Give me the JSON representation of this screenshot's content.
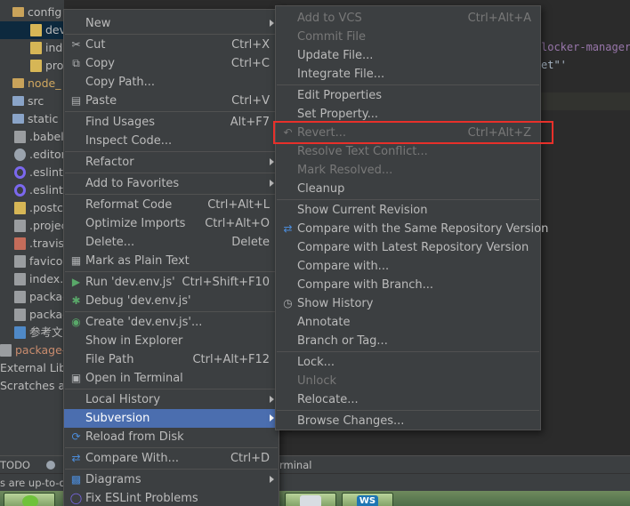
{
  "project_tree": {
    "rows": [
      {
        "label": "config",
        "icon": "folder-icon",
        "kind": "folder-o"
      },
      {
        "label": "dev",
        "icon": "js-file-icon",
        "kind": "js",
        "selected": true
      },
      {
        "label": "ind",
        "icon": "js-file-icon",
        "kind": "js"
      },
      {
        "label": "pro",
        "icon": "js-file-icon",
        "kind": "js"
      },
      {
        "label": "node_",
        "icon": "folder-icon",
        "kind": "folder-o",
        "orange": true
      },
      {
        "label": "src",
        "icon": "folder-icon",
        "kind": "folder"
      },
      {
        "label": "static",
        "icon": "folder-icon",
        "kind": "folder"
      },
      {
        "label": ".babel",
        "icon": "file-icon",
        "kind": "file"
      },
      {
        "label": ".editor",
        "icon": "gear-icon",
        "kind": "gear"
      },
      {
        "label": ".eslinti",
        "icon": "eslint-icon",
        "kind": "eslint"
      },
      {
        "label": ".eslintr",
        "icon": "eslint-icon",
        "kind": "eslint"
      },
      {
        "label": ".postc",
        "icon": "js-file-icon",
        "kind": "js"
      },
      {
        "label": ".projec",
        "icon": "file-icon",
        "kind": "file"
      },
      {
        "label": ".travis.",
        "icon": "yml-file-icon",
        "kind": "yml"
      },
      {
        "label": "favicor",
        "icon": "file-icon",
        "kind": "file"
      },
      {
        "label": "index.h",
        "icon": "html-file-icon",
        "kind": "file"
      },
      {
        "label": "packag",
        "icon": "file-icon",
        "kind": "file"
      },
      {
        "label": "packag",
        "icon": "file-icon",
        "kind": "file"
      },
      {
        "label": "参考文",
        "icon": "md-file-icon",
        "kind": "md"
      },
      {
        "label": "package-",
        "icon": "file-icon",
        "kind": "file",
        "modified": true
      },
      {
        "label": "External Libr",
        "icon": "",
        "kind": "none"
      },
      {
        "label": "Scratches an",
        "icon": "",
        "kind": "none"
      }
    ]
  },
  "editor": {
    "lines": [
      {
        "text": "locker-manager",
        "color": "#9876aa"
      },
      {
        "text": "et\"'",
        "color": "#a9b7c6"
      }
    ]
  },
  "bottom_bar": {
    "todo_label": "TODO",
    "terminal_label": "rminal"
  },
  "status_bar": {
    "text": "s are up-to-d"
  },
  "taskbar": {
    "ws_label": "WS"
  },
  "context_menu": {
    "items": [
      {
        "label": "New",
        "shortcut": "",
        "submenu": true,
        "icon": ""
      },
      {
        "sep": true
      },
      {
        "label": "Cut",
        "shortcut": "Ctrl+X",
        "icon": "cut-icon",
        "glyph": "✂"
      },
      {
        "label": "Copy",
        "shortcut": "Ctrl+C",
        "icon": "copy-icon",
        "glyph": "⧉"
      },
      {
        "label": "Copy Path...",
        "shortcut": "",
        "icon": ""
      },
      {
        "label": "Paste",
        "shortcut": "Ctrl+V",
        "icon": "paste-icon",
        "glyph": "▤"
      },
      {
        "sep": true
      },
      {
        "label": "Find Usages",
        "shortcut": "Alt+F7",
        "icon": ""
      },
      {
        "label": "Inspect Code...",
        "shortcut": "",
        "icon": ""
      },
      {
        "sep": true
      },
      {
        "label": "Refactor",
        "shortcut": "",
        "submenu": true,
        "icon": ""
      },
      {
        "sep": true
      },
      {
        "label": "Add to Favorites",
        "shortcut": "",
        "submenu": true,
        "icon": ""
      },
      {
        "sep": true
      },
      {
        "label": "Reformat Code",
        "shortcut": "Ctrl+Alt+L",
        "icon": ""
      },
      {
        "label": "Optimize Imports",
        "shortcut": "Ctrl+Alt+O",
        "icon": ""
      },
      {
        "label": "Delete...",
        "shortcut": "Delete",
        "icon": ""
      },
      {
        "label": "Mark as Plain Text",
        "shortcut": "",
        "icon": "plain-text-icon",
        "glyph": "▦"
      },
      {
        "sep": true
      },
      {
        "label": "Run 'dev.env.js'",
        "shortcut": "Ctrl+Shift+F10",
        "icon": "run-icon",
        "glyph": "▶",
        "glyph_color": "#59a869"
      },
      {
        "label": "Debug 'dev.env.js'",
        "shortcut": "",
        "icon": "debug-icon",
        "glyph": "✱",
        "glyph_color": "#59a869"
      },
      {
        "sep": true
      },
      {
        "label": "Create 'dev.env.js'...",
        "shortcut": "",
        "icon": "create-config-icon",
        "glyph": "◉",
        "glyph_color": "#59a869"
      },
      {
        "label": "Show in Explorer",
        "shortcut": "",
        "icon": ""
      },
      {
        "label": "File Path",
        "shortcut": "Ctrl+Alt+F12",
        "icon": ""
      },
      {
        "label": "Open in Terminal",
        "shortcut": "",
        "icon": "terminal-icon",
        "glyph": "▣"
      },
      {
        "sep": true
      },
      {
        "label": "Local History",
        "shortcut": "",
        "submenu": true,
        "icon": ""
      },
      {
        "label": "Subversion",
        "shortcut": "",
        "submenu": true,
        "icon": "",
        "highlighted": true
      },
      {
        "label": "Reload from Disk",
        "shortcut": "",
        "icon": "reload-icon",
        "glyph": "⟳",
        "glyph_color": "#4b8bd8"
      },
      {
        "sep": true
      },
      {
        "label": "Compare With...",
        "shortcut": "Ctrl+D",
        "icon": "compare-icon",
        "glyph": "⇄",
        "glyph_color": "#4b8bd8"
      },
      {
        "sep": true
      },
      {
        "label": "Diagrams",
        "shortcut": "",
        "submenu": true,
        "icon": "diagram-icon",
        "glyph": "▩",
        "glyph_color": "#4b8bd8"
      },
      {
        "label": "Fix ESLint Problems",
        "shortcut": "",
        "icon": "eslint-icon",
        "glyph": "◯",
        "glyph_color": "#7b68ee"
      }
    ]
  },
  "vcs_submenu": {
    "items": [
      {
        "label": "Add to VCS",
        "shortcut": "Ctrl+Alt+A",
        "disabled": true
      },
      {
        "label": "Commit File",
        "shortcut": "",
        "disabled": true
      },
      {
        "label": "Update File...",
        "shortcut": ""
      },
      {
        "label": "Integrate File...",
        "shortcut": ""
      },
      {
        "sep": true
      },
      {
        "label": "Edit Properties",
        "shortcut": ""
      },
      {
        "label": "Set Property...",
        "shortcut": ""
      },
      {
        "label": "Revert...",
        "shortcut": "Ctrl+Alt+Z",
        "disabled": true,
        "icon": "revert-icon",
        "glyph": "↶"
      },
      {
        "label": "Resolve Text Conflict...",
        "shortcut": "",
        "disabled": true
      },
      {
        "label": "Mark Resolved...",
        "shortcut": "",
        "disabled": true
      },
      {
        "label": "Cleanup",
        "shortcut": ""
      },
      {
        "sep": true
      },
      {
        "label": "Show Current Revision",
        "shortcut": ""
      },
      {
        "label": "Compare with the Same Repository Version",
        "shortcut": "",
        "icon": "compare-icon",
        "glyph": "⇄",
        "glyph_color": "#4b8bd8"
      },
      {
        "label": "Compare with Latest Repository Version",
        "shortcut": ""
      },
      {
        "label": "Compare with...",
        "shortcut": ""
      },
      {
        "label": "Compare with Branch...",
        "shortcut": ""
      },
      {
        "label": "Show History",
        "shortcut": "",
        "icon": "history-icon",
        "glyph": "◷"
      },
      {
        "label": "Annotate",
        "shortcut": ""
      },
      {
        "label": "Branch or Tag...",
        "shortcut": ""
      },
      {
        "sep": true
      },
      {
        "label": "Lock...",
        "shortcut": ""
      },
      {
        "label": "Unlock",
        "shortcut": "",
        "disabled": true
      },
      {
        "label": "Relocate...",
        "shortcut": ""
      },
      {
        "sep": true
      },
      {
        "label": "Browse Changes...",
        "shortcut": ""
      }
    ]
  }
}
